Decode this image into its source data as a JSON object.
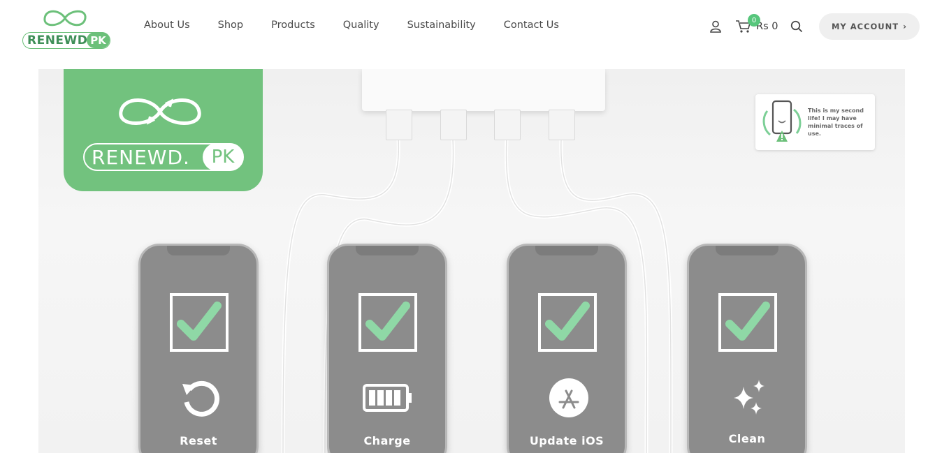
{
  "brand": {
    "name": "RENEWD.",
    "suffix": "PK"
  },
  "nav": {
    "items": [
      "About Us",
      "Shop",
      "Products",
      "Quality",
      "Sustainability",
      "Contact Us"
    ]
  },
  "header": {
    "cart_count": "0",
    "cart_total": "Rs 0",
    "account_label": "MY ACCOUNT",
    "account_chevron": "›"
  },
  "icons": {
    "user": "user-icon",
    "cart": "cart-icon",
    "search": "search-icon"
  },
  "hero": {
    "sticker_text": "This is my second life! I may have minimal traces of use.",
    "steps": [
      {
        "label": "Reset",
        "icon": "reset-icon"
      },
      {
        "label": "Charge",
        "icon": "battery-icon"
      },
      {
        "label": "Update iOS",
        "icon": "app-store-icon"
      },
      {
        "label": "Clean",
        "icon": "sparkle-icon"
      }
    ]
  },
  "colors": {
    "brand_green": "#72c27e",
    "check_green": "#8fd8a6",
    "badge_green": "#57c67c"
  }
}
